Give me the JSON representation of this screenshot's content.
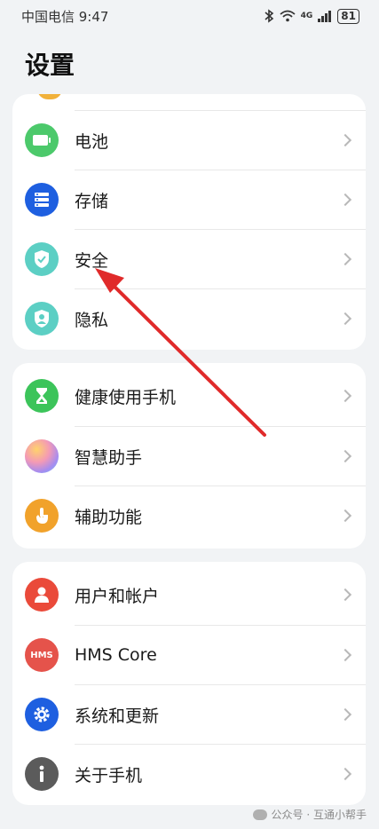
{
  "status_bar": {
    "carrier_time": "中国电信 9:47",
    "network": "4G",
    "battery": "81"
  },
  "page_title": "设置",
  "groups": [
    {
      "items": [
        {
          "label": "电池",
          "icon": "battery-icon",
          "color": "#4cc96b"
        },
        {
          "label": "存储",
          "icon": "storage-icon",
          "color": "#1e5fe0"
        },
        {
          "label": "安全",
          "icon": "security-shield-icon",
          "color": "#5ccfc4"
        },
        {
          "label": "隐私",
          "icon": "privacy-icon",
          "color": "#5ccfc4"
        }
      ]
    },
    {
      "items": [
        {
          "label": "健康使用手机",
          "icon": "hourglass-icon",
          "color": "#3cc45a"
        },
        {
          "label": "智慧助手",
          "icon": "assistant-icon",
          "color": "#c98ee8"
        },
        {
          "label": "辅助功能",
          "icon": "accessibility-hand-icon",
          "color": "#f1a22b"
        }
      ]
    },
    {
      "items": [
        {
          "label": "用户和帐户",
          "icon": "user-icon",
          "color": "#ea4a3a"
        },
        {
          "label": "HMS Core",
          "icon": "hms-icon",
          "color": "#e5534b",
          "icon_text": "HMS"
        },
        {
          "label": "系统和更新",
          "icon": "gear-icon",
          "color": "#1e5fe0"
        },
        {
          "label": "关于手机",
          "icon": "info-icon",
          "color": "#5b5b5b"
        }
      ]
    }
  ],
  "watermark": "公众号 · 互通小帮手"
}
